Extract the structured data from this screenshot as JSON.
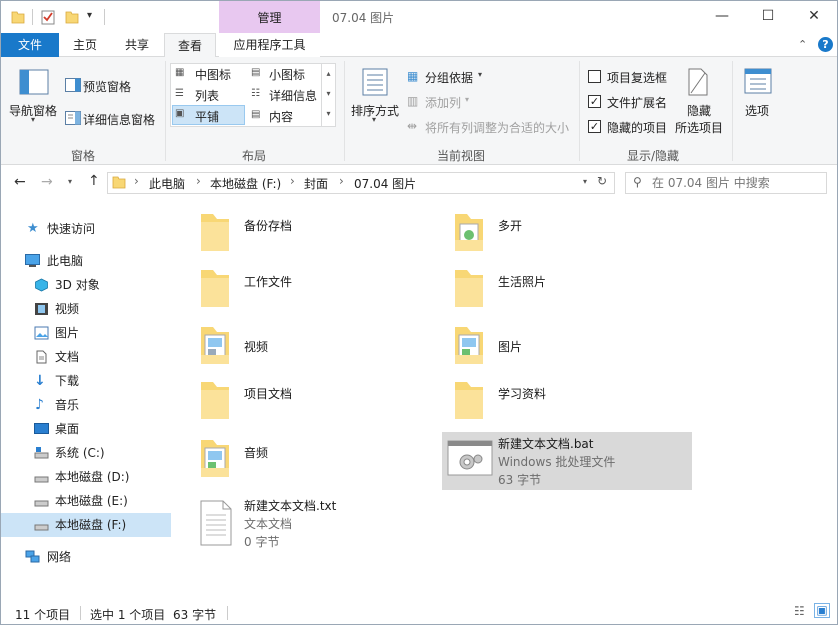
{
  "window": {
    "title": "07.04 图片",
    "context_tab": "管理",
    "buttons": {
      "minimize": "—",
      "maximize": "☐",
      "close": "✕"
    }
  },
  "ribbon_tabs": [
    "文件",
    "主页",
    "共享",
    "查看",
    "应用程序工具"
  ],
  "ribbon": {
    "panes": {
      "label": "窗格",
      "nav_pane": "导航窗格",
      "preview_pane": "预览窗格",
      "details_pane": "详细信息窗格"
    },
    "layout": {
      "label": "布局",
      "options": [
        "中图标",
        "小图标",
        "列表",
        "详细信息",
        "平铺",
        "内容"
      ],
      "selected": "平铺"
    },
    "current_view": {
      "label": "当前视图",
      "sort_by": "排序方式",
      "group_by": "分组依据",
      "add_column": "添加列",
      "size_all_columns": "将所有列调整为合适的大小"
    },
    "show_hide": {
      "label": "显示/隐藏",
      "item_checkboxes": "项目复选框",
      "file_extensions": "文件扩展名",
      "hidden_items": "隐藏的项目",
      "hide_selected_1": "隐藏",
      "hide_selected_2": "所选项目",
      "checks": {
        "item_checkboxes": false,
        "file_extensions": true,
        "hidden_items": true
      }
    },
    "options": {
      "label": "选项"
    }
  },
  "address": {
    "crumbs": [
      "此电脑",
      "本地磁盘 (F:)",
      "封面",
      "07.04 图片"
    ],
    "search_placeholder": "在 07.04 图片 中搜索"
  },
  "nav": {
    "quick_access": "快速访问",
    "this_pc": "此电脑",
    "items": [
      "3D 对象",
      "视频",
      "图片",
      "文档",
      "下载",
      "音乐",
      "桌面",
      "系统 (C:)",
      "本地磁盘 (D:)",
      "本地磁盘 (E:)",
      "本地磁盘 (F:)"
    ],
    "network": "网络",
    "selected": "本地磁盘 (F:)"
  },
  "files": [
    {
      "name": "备份存档",
      "type": "folder"
    },
    {
      "name": "多开",
      "type": "folder"
    },
    {
      "name": "工作文件",
      "type": "folder"
    },
    {
      "name": "生活照片",
      "type": "folder"
    },
    {
      "name": "视频",
      "type": "folder"
    },
    {
      "name": "图片",
      "type": "folder"
    },
    {
      "name": "项目文档",
      "type": "folder"
    },
    {
      "name": "学习资料",
      "type": "folder"
    },
    {
      "name": "音频",
      "type": "folder"
    },
    {
      "name": "新建文本文档.bat",
      "type": "bat",
      "kind": "Windows 批处理文件",
      "size": "63 字节",
      "selected": true
    },
    {
      "name": "新建文本文档.txt",
      "type": "txt",
      "kind": "文本文档",
      "size": "0 字节"
    }
  ],
  "status": {
    "count": "11 个项目",
    "selection": "选中 1 个项目",
    "selection_size": "63 字节"
  },
  "colors": {
    "file_tab": "#1979ca",
    "context_tab": "#e8c8f0",
    "selection": "#d9d9d9",
    "nav_selection": "#cce4f7",
    "folder": "#f8d775"
  }
}
